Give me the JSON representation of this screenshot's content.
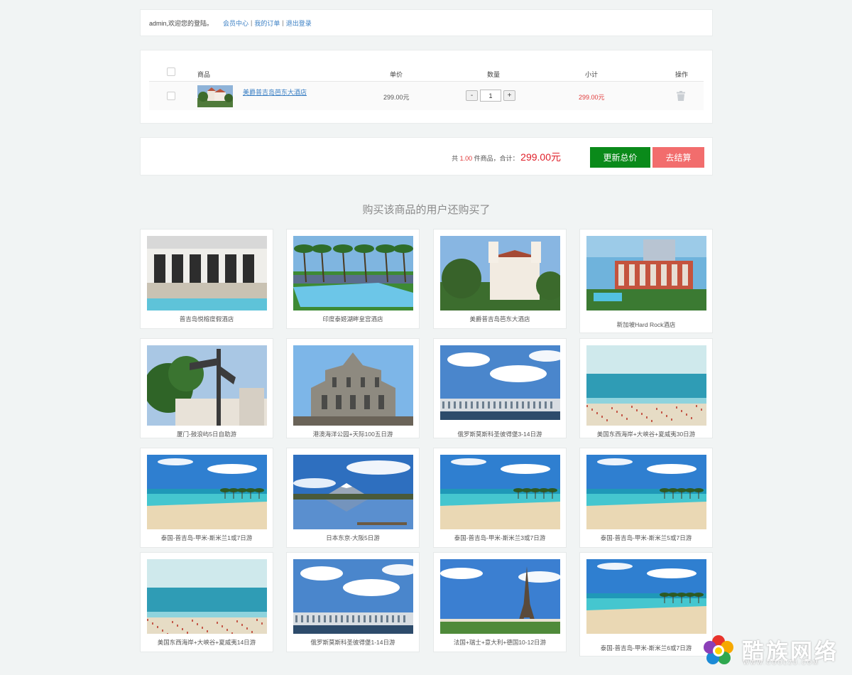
{
  "topbar": {
    "welcome": "admin,欢迎您的登陆。",
    "links": [
      "会员中心",
      "我的订单",
      "退出登录"
    ]
  },
  "cart": {
    "headers": {
      "product": "商品",
      "unit_price": "单价",
      "quantity": "数量",
      "subtotal": "小计",
      "action": "操作"
    },
    "items": [
      {
        "name": "美爵普吉岛芭东大酒店",
        "price": "299.00元",
        "qty": "1",
        "subtotal": "299.00元"
      }
    ],
    "minus": "-",
    "plus": "+"
  },
  "summary": {
    "prefix": "共",
    "count": "1.00",
    "mid": "件商品，合计：",
    "total": "299.00元",
    "update_btn": "更新总价",
    "checkout_btn": "去结算"
  },
  "recommend": {
    "title": "购买该商品的用户还购买了",
    "items": [
      {
        "name": "普吉岛悦榕度假酒店",
        "scene": "hotel-pool"
      },
      {
        "name": "印度泰姬湖畔皇宫酒店",
        "scene": "palm-pool"
      },
      {
        "name": "美爵普吉岛芭东大酒店",
        "scene": "church"
      },
      {
        "name": "新加坡Hard Rock酒店",
        "scene": "resort"
      },
      {
        "name": "厦门-鼓浪屿5日自助游",
        "scene": "signpost"
      },
      {
        "name": "港澳海洋公园+天际100五日游",
        "scene": "ruins"
      },
      {
        "name": "俄罗斯莫斯科圣彼得堡3-14日游",
        "scene": "palace"
      },
      {
        "name": "美国东西海岸+大峡谷+夏威夷30日游",
        "scene": "beach-crowd"
      },
      {
        "name": "泰国-普吉岛-甲米-斯米兰1或7日游",
        "scene": "tropical-beach"
      },
      {
        "name": "日本东京-大阪5日游",
        "scene": "fuji"
      },
      {
        "name": "泰国-普吉岛-甲米-斯米兰3或7日游",
        "scene": "tropical-beach"
      },
      {
        "name": "泰国-普吉岛-甲米-斯米兰5或7日游",
        "scene": "tropical-beach"
      },
      {
        "name": "美国东西海岸+大峡谷+夏威夷14日游",
        "scene": "beach-crowd"
      },
      {
        "name": "俄罗斯莫斯科圣彼得堡1-14日游",
        "scene": "palace"
      },
      {
        "name": "法国+瑞士+意大利+德国10-12日游",
        "scene": "eiffel"
      },
      {
        "name": "泰国-普吉岛-甲米-斯米兰6或7日游",
        "scene": "tropical-beach"
      }
    ]
  },
  "watermark": {
    "text": "酷族网络",
    "url": "WWW.COOLZU.COM"
  },
  "colors": {
    "link": "#3a7fc4",
    "price_red": "#e03a3a",
    "update_green": "#0a8a1a",
    "checkout_pink": "#f26d6d"
  }
}
